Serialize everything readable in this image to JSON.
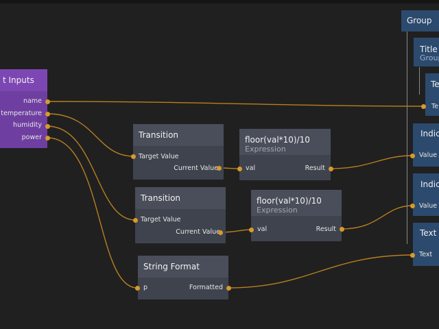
{
  "inputs_node": {
    "title": "t Inputs",
    "outputs": [
      "name",
      "temperature",
      "humidity",
      "power"
    ]
  },
  "transition_1": {
    "title": "Transition",
    "input": "Target Value",
    "output": "Current Value"
  },
  "transition_2": {
    "title": "Transition",
    "input": "Target Value",
    "output": "Current Value"
  },
  "expression_1": {
    "title": "floor(val*10)/10",
    "subtitle": "Expression",
    "input": "val",
    "output": "Result"
  },
  "expression_2": {
    "title": "floor(val*10)/10",
    "subtitle": "Expression",
    "input": "val",
    "output": "Result"
  },
  "string_format": {
    "title": "String Format",
    "input": "p",
    "output": "Formatted"
  },
  "group_node": {
    "title": "Group"
  },
  "title_node": {
    "title": "Title",
    "subtitle": "Group"
  },
  "text_node_1": {
    "title": "Te",
    "input": "Te"
  },
  "indicator_1": {
    "title": "Indica",
    "input": "Value"
  },
  "indicator_2": {
    "title": "Indica",
    "input": "Value"
  },
  "text_node_2": {
    "title": "Text",
    "input": "Text"
  },
  "colors": {
    "wire": "#d79a2a",
    "node": "#3f434e",
    "inputs_node": "#6e3fa0",
    "visual_node": "#2c4a6e",
    "background": "#202020"
  }
}
